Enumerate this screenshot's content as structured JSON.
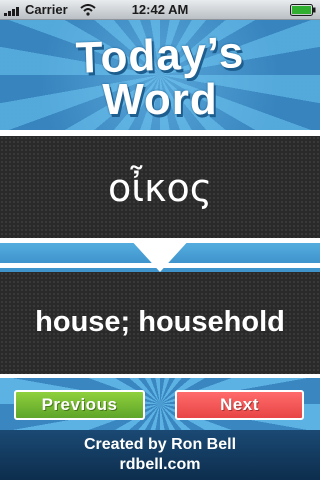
{
  "status_bar": {
    "carrier": "Carrier",
    "time": "12:42 AM",
    "icons": [
      "signal-icon",
      "wifi-icon",
      "battery-icon"
    ]
  },
  "header": {
    "title_line1": "Today’s",
    "title_line2": "Word"
  },
  "word": {
    "greek": "οἶκος",
    "definition": "house; household"
  },
  "nav": {
    "previous_label": "Previous",
    "next_label": "Next"
  },
  "footer": {
    "credit": "Created by Ron Bell",
    "site": "rdbell.com"
  },
  "colors": {
    "accent_blue": "#3f94cc",
    "previous_green": "#6fb830",
    "next_red": "#f25858",
    "panel_dark": "#2a2a2a"
  }
}
